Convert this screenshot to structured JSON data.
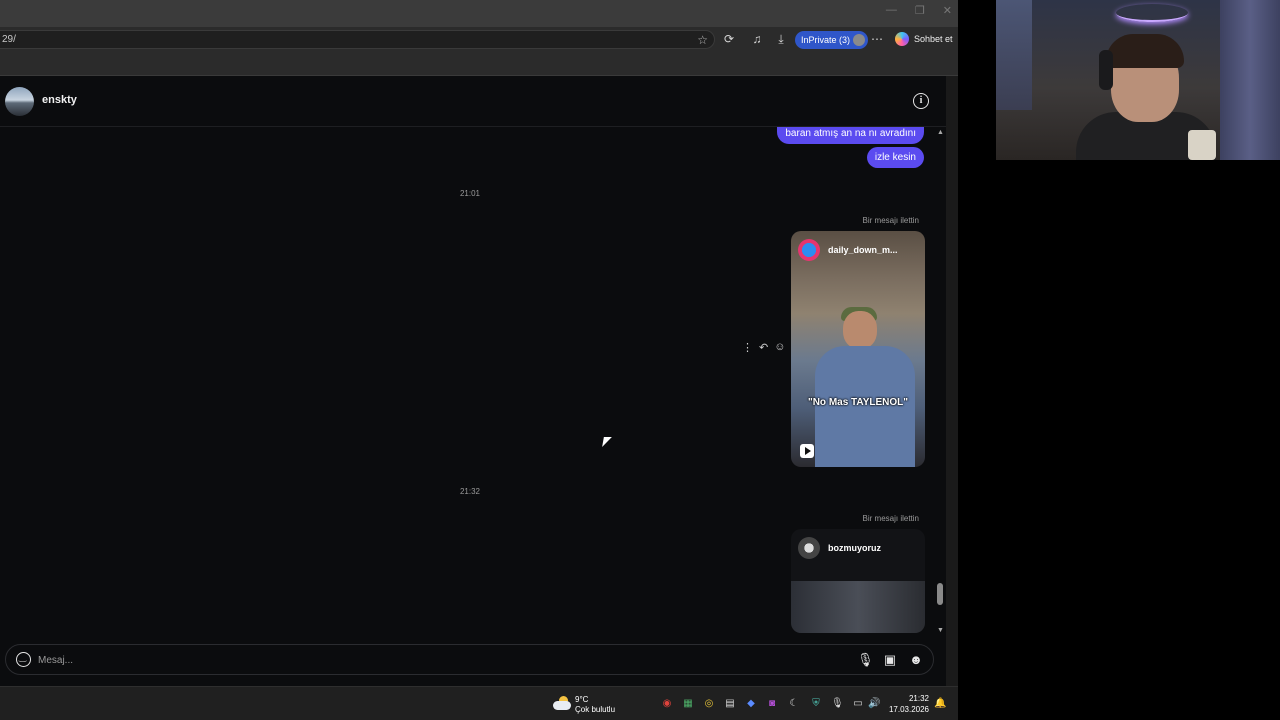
{
  "browser": {
    "url": "29/",
    "inprivate_label": "InPrivate (3)",
    "copilot_label": "Sohbet et",
    "window_controls": [
      "—",
      "❐",
      "✕"
    ]
  },
  "chat": {
    "contact_name": "enskty",
    "messages": [
      {
        "type": "text",
        "text": "baran atmış an na nı avradını"
      },
      {
        "type": "text",
        "text": "izle kesin"
      },
      {
        "type": "timestamp",
        "text": "21:01"
      },
      {
        "type": "forwarded",
        "label": "Bir mesajı ilettin",
        "owner": "daily_down_m...",
        "caption": "\"No Mas TAYLENOL\""
      },
      {
        "type": "timestamp",
        "text": "21:32"
      },
      {
        "type": "forwarded",
        "label": "Bir mesajı ilettin",
        "owner": "bozmuyoruz"
      }
    ],
    "composer_placeholder": "Mesaj..."
  },
  "taskbar": {
    "temperature": "9°C",
    "condition": "Çok bulutlu",
    "time": "21:32",
    "date": "17.03.2026"
  },
  "colors": {
    "accent": "#5b4bf0",
    "inprivate": "#2f56c9",
    "background": "#0b0c0e"
  }
}
